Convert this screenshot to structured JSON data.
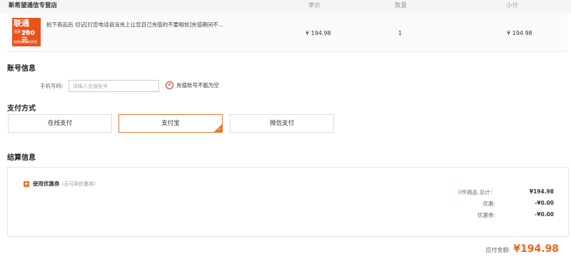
{
  "table_header": {
    "shop_name": "新希望通信专营店",
    "col_price": "单价",
    "col_qty": "数量",
    "col_subtotal": "小计"
  },
  "order_item": {
    "thumb": {
      "brand": "联通",
      "sub": "话费\n充值",
      "amount": "200元",
      "tagline": "充值快速 诚信经营"
    },
    "title": "拍下商品后 切记[打您电话说没充上让您自己充值的不要相信]充值期间不...",
    "price": "¥ 194.98",
    "qty": "1",
    "subtotal": "¥ 194.98"
  },
  "account": {
    "title": "账号信息",
    "phone_label": "手机号码:",
    "phone_value": "",
    "phone_placeholder": "请输入充值账号",
    "error_text": "充值账号不能为空"
  },
  "payment": {
    "title": "支付方式",
    "options": [
      {
        "label": "在线支付",
        "selected": false
      },
      {
        "label": "支付宝",
        "selected": true
      },
      {
        "label": "微信支付",
        "selected": false
      }
    ]
  },
  "settlement": {
    "title": "结算信息",
    "coupon_label": "使用优惠券",
    "coupon_note": "(无可用优惠券)",
    "item_count": "0",
    "item_count_suffix": "件商品",
    "total_label": "总计：",
    "total_value": "¥194.98",
    "discount_label": "优惠:",
    "discount_value": "-¥0.00",
    "voucher_label": "优惠券:",
    "voucher_value": "-¥0.00",
    "payable_label": "应付金额:",
    "payable_value": "¥194.98"
  },
  "colors": {
    "accent": "#e8742e",
    "price": "#f56114",
    "error": "#d9261c"
  }
}
